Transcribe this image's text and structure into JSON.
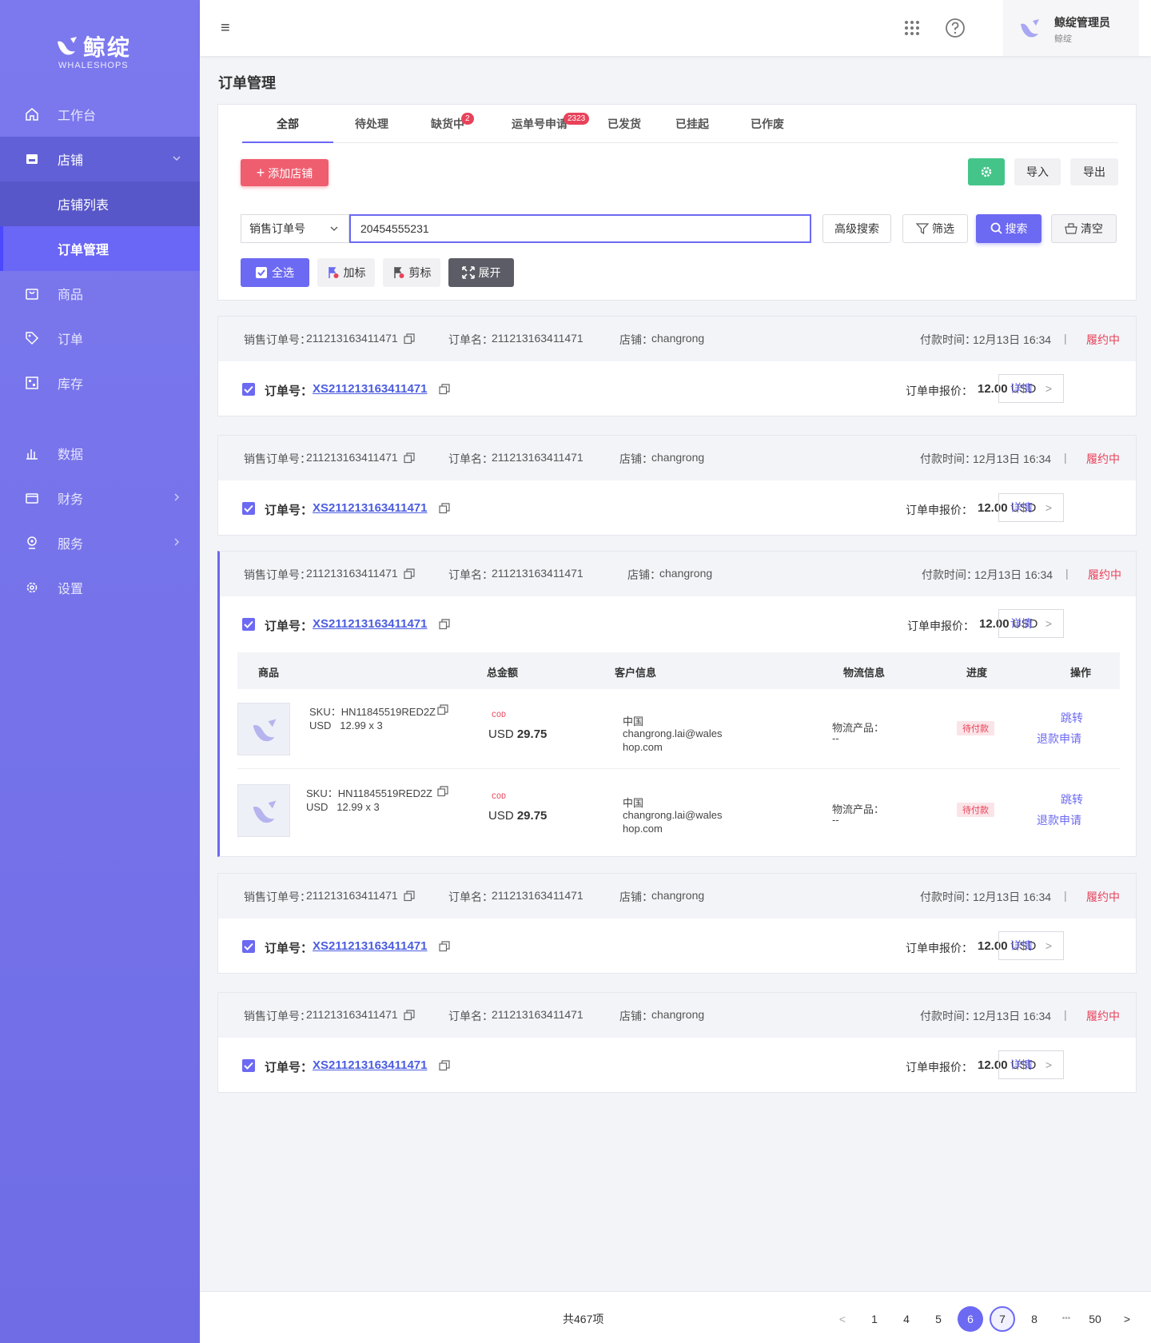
{
  "brand": {
    "name_cn": "鲸绽",
    "name_en": "WHALESHOPS"
  },
  "sidebar": {
    "items": [
      {
        "label": "工作台",
        "icon": "home-icon"
      },
      {
        "label": "店铺",
        "icon": "store-icon"
      },
      {
        "label": "店铺列表"
      },
      {
        "label": "订单管理"
      },
      {
        "label": "商品",
        "icon": "bag-icon"
      },
      {
        "label": "订单",
        "icon": "tag-icon"
      },
      {
        "label": "库存",
        "icon": "inventory-icon"
      },
      {
        "label": "数据",
        "icon": "chart-icon"
      },
      {
        "label": "财务",
        "icon": "wallet-icon"
      },
      {
        "label": "服务",
        "icon": "service-icon"
      },
      {
        "label": "设置",
        "icon": "gear-icon"
      }
    ]
  },
  "topbar": {
    "menu_glyph": "≡",
    "user_name": "鲸绽管理员",
    "user_sub": "鲸绽"
  },
  "page": {
    "title": "订单管理"
  },
  "tabs": [
    {
      "label": "全部"
    },
    {
      "label": "待处理"
    },
    {
      "label": "缺货中",
      "badge": "2"
    },
    {
      "label": "运单号申请",
      "badge": "2323"
    },
    {
      "label": "已发货"
    },
    {
      "label": "已挂起"
    },
    {
      "label": "已作废"
    }
  ],
  "toolbar": {
    "add_store": "添加店铺",
    "import": "导入",
    "export": "导出"
  },
  "search": {
    "field_select": "销售订单号",
    "value": "20454555231",
    "advanced": "高级搜索",
    "filter": "筛选",
    "search": "搜索",
    "clear": "清空"
  },
  "bulk": {
    "select_all": "全选",
    "add_mark": "加标",
    "cut_mark": "剪标",
    "expand": "展开"
  },
  "order_labels": {
    "sales_order_no": "销售订单号：",
    "order_name": "订单名：",
    "store": "店铺：",
    "paid_time": "付款时间：",
    "separator": "|",
    "order_no": "订单号：",
    "quote": "订单申报价：",
    "detail": "详情",
    "detail_arrow": ">"
  },
  "orders": [
    {
      "sales_no": "211213163411471",
      "name": "211213163411471",
      "store": "changrong",
      "paid": "12月13日 16:34",
      "status": "履约中",
      "order_no": "XS211213163411471",
      "price": "12.00",
      "currency": "USD"
    },
    {
      "sales_no": "211213163411471",
      "name": "211213163411471",
      "store": "changrong",
      "paid": "12月13日 16:34",
      "status": "履约中",
      "order_no": "XS211213163411471",
      "price": "12.00",
      "currency": "USD"
    },
    {
      "sales_no": "211213163411471",
      "name": "211213163411471",
      "store": "changrong",
      "paid": "12月13日 16:34",
      "status": "履约中",
      "order_no": "XS211213163411471",
      "price": "12.00",
      "currency": "USD"
    },
    {
      "sales_no": "211213163411471",
      "name": "211213163411471",
      "store": "changrong",
      "paid": "12月13日 16:34",
      "status": "履约中",
      "order_no": "XS211213163411471",
      "price": "12.00",
      "currency": "USD"
    },
    {
      "sales_no": "211213163411471",
      "name": "211213163411471",
      "store": "changrong",
      "paid": "12月13日 16:34",
      "status": "履约中",
      "order_no": "XS211213163411471",
      "price": "12.00",
      "currency": "USD"
    }
  ],
  "sub_table": {
    "headers": [
      "商品",
      "总金额",
      "客户信息",
      "物流信息",
      "进度",
      "操作"
    ],
    "rows": [
      {
        "sku": "SKU：HN11845519RED2Z",
        "unit": "USD   12.99 x 3",
        "cod": "COD",
        "amount_cur": "USD",
        "amount": "29.75",
        "country": "中国",
        "email1": "changrong.lai@wales",
        "email2": "hop.com",
        "logistics": "物流产品：",
        "logistics_val": "--",
        "progress": "待付款",
        "action1": "跳转",
        "action2": "退款申请"
      },
      {
        "sku": "SKU：HN11845519RED2Z",
        "unit": "USD   12.99 x 3",
        "cod": "COD",
        "amount_cur": "USD",
        "amount": "29.75",
        "country": "中国",
        "email1": "changrong.lai@wales",
        "email2": "hop.com",
        "logistics": "物流产品：",
        "logistics_val": "--",
        "progress": "待付款",
        "action1": "跳转",
        "action2": "退款申请"
      }
    ]
  },
  "pager": {
    "total": "共467项",
    "prev": "<",
    "next": ">",
    "ellipsis": "•••",
    "pages": [
      "1",
      "4",
      "5",
      "6",
      "7",
      "8",
      "50"
    ],
    "current": "6"
  },
  "colors": {
    "sidebar": "#7c79ee",
    "accent": "#6c69f2",
    "danger": "#e8425a",
    "success": "#45c48a"
  }
}
